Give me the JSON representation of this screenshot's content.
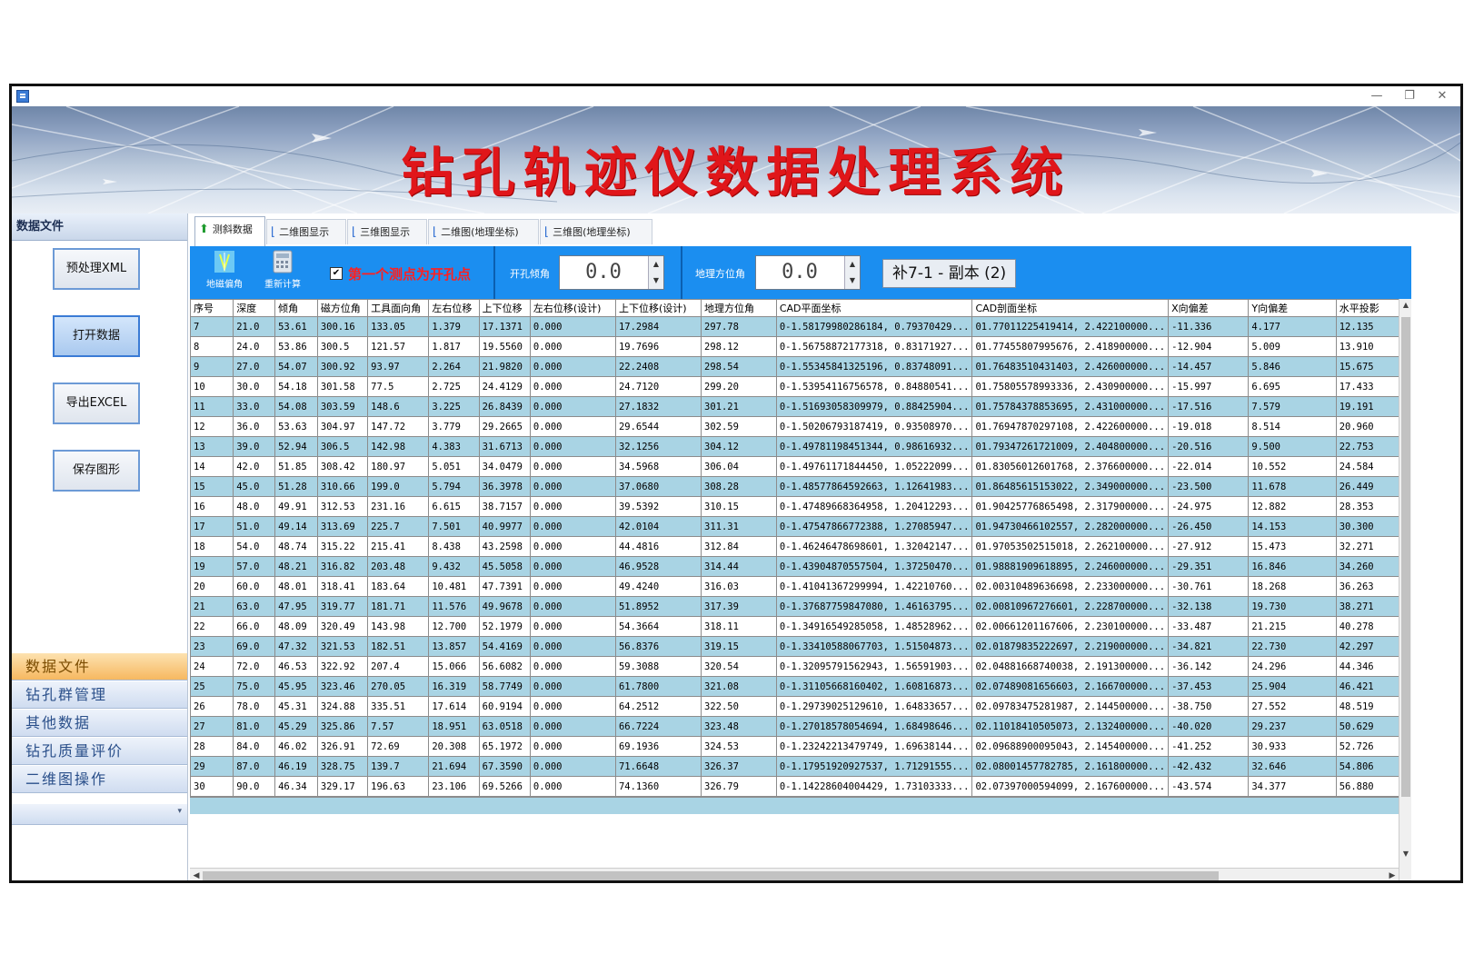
{
  "window": {
    "title_buttons": {
      "minimize": "—",
      "maximize": "❐",
      "close": "✕"
    }
  },
  "banner": {
    "title": "钻孔轨迹仪数据处理系统"
  },
  "left_panel": {
    "header": "数据文件",
    "buttons": [
      "预处理XML",
      "打开数据",
      "导出EXCEL",
      "保存图形"
    ],
    "active_button_index": 1,
    "nav_items": [
      "数据文件",
      "钻孔群管理",
      "其他数据",
      "钻孔质量评价",
      "二维图操作"
    ],
    "active_nav_index": 0
  },
  "tabs": {
    "items": [
      "测斜数据",
      "二维图显示",
      "三维图显示",
      "二维图(地理坐标)",
      "三维图(地理坐标)"
    ],
    "active_index": 0
  },
  "toolbar": {
    "btn_magnetic": "地磁偏角",
    "btn_recalc": "重新计算",
    "checkbox_label": "第一个测点为开孔点",
    "checkbox_checked": true,
    "hole_angle_label": "开孔倾角",
    "hole_angle_value": "0.0",
    "geo_azimuth_label": "地理方位角",
    "geo_azimuth_value": "0.0",
    "file_name": "补7-1 - 副本 (2)"
  },
  "table": {
    "columns": [
      "序号",
      "深度",
      "倾角",
      "磁方位角",
      "工具面向角",
      "左右位移",
      "上下位移",
      "左右位移(设计)",
      "上下位移(设计)",
      "地理方位角",
      "CAD平面坐标",
      "CAD剖面坐标",
      "X向偏差",
      "Y向偏差",
      "水平投影"
    ],
    "rows": [
      [
        "7",
        "21.0",
        "53.61",
        "300.16",
        "133.05",
        "1.379",
        "17.1371",
        "0.000",
        "17.2984",
        "297.78",
        "0-1.58179980286184, 0.79370429...",
        "01.77011225419414, 2.422100000...",
        "-11.336",
        "4.177",
        "12.135"
      ],
      [
        "8",
        "24.0",
        "53.86",
        "300.5",
        "121.57",
        "1.817",
        "19.5560",
        "0.000",
        "19.7696",
        "298.12",
        "0-1.56758872177318, 0.83171927...",
        "01.77455807995676, 2.418900000...",
        "-12.904",
        "5.009",
        "13.910"
      ],
      [
        "9",
        "27.0",
        "54.07",
        "300.92",
        "93.97",
        "2.264",
        "21.9820",
        "0.000",
        "22.2408",
        "298.54",
        "0-1.55345841325196, 0.83748091...",
        "01.76483510431403, 2.426000000...",
        "-14.457",
        "5.846",
        "15.675"
      ],
      [
        "10",
        "30.0",
        "54.18",
        "301.58",
        "77.5",
        "2.725",
        "24.4129",
        "0.000",
        "24.7120",
        "299.20",
        "0-1.53954116756578, 0.84880541...",
        "01.75805578993336, 2.430900000...",
        "-15.997",
        "6.695",
        "17.433"
      ],
      [
        "11",
        "33.0",
        "54.08",
        "303.59",
        "148.6",
        "3.225",
        "26.8439",
        "0.000",
        "27.1832",
        "301.21",
        "0-1.51693058309979, 0.88425904...",
        "01.75784378853695, 2.431000000...",
        "-17.516",
        "7.579",
        "19.191"
      ],
      [
        "12",
        "36.0",
        "53.63",
        "304.97",
        "147.72",
        "3.779",
        "29.2665",
        "0.000",
        "29.6544",
        "302.59",
        "0-1.50206793187419, 0.93508970...",
        "01.76947870297108, 2.422600000...",
        "-19.018",
        "8.514",
        "20.960"
      ],
      [
        "13",
        "39.0",
        "52.94",
        "306.5",
        "142.98",
        "4.383",
        "31.6713",
        "0.000",
        "32.1256",
        "304.12",
        "0-1.49781198451344, 0.98616932...",
        "01.79347261721009, 2.404800000...",
        "-20.516",
        "9.500",
        "22.753"
      ],
      [
        "14",
        "42.0",
        "51.85",
        "308.42",
        "180.97",
        "5.051",
        "34.0479",
        "0.000",
        "34.5968",
        "306.04",
        "0-1.49761171844450, 1.05222099...",
        "01.83056012601768, 2.376600000...",
        "-22.014",
        "10.552",
        "24.584"
      ],
      [
        "15",
        "45.0",
        "51.28",
        "310.66",
        "199.0",
        "5.794",
        "36.3978",
        "0.000",
        "37.0680",
        "308.28",
        "0-1.48577864592663, 1.12641983...",
        "01.86485615153022, 2.349000000...",
        "-23.500",
        "11.678",
        "26.449"
      ],
      [
        "16",
        "48.0",
        "49.91",
        "312.53",
        "231.16",
        "6.615",
        "38.7157",
        "0.000",
        "39.5392",
        "310.15",
        "0-1.47489668364958, 1.20412293...",
        "01.90425776865498, 2.317900000...",
        "-24.975",
        "12.882",
        "28.353"
      ],
      [
        "17",
        "51.0",
        "49.14",
        "313.69",
        "225.7",
        "7.501",
        "40.9977",
        "0.000",
        "42.0104",
        "311.31",
        "0-1.47547866772388, 1.27085947...",
        "01.94730466102557, 2.282000000...",
        "-26.450",
        "14.153",
        "30.300"
      ],
      [
        "18",
        "54.0",
        "48.74",
        "315.22",
        "215.41",
        "8.438",
        "43.2598",
        "0.000",
        "44.4816",
        "312.84",
        "0-1.46246478698601, 1.32042147...",
        "01.97053502515018, 2.262100000...",
        "-27.912",
        "15.473",
        "32.271"
      ],
      [
        "19",
        "57.0",
        "48.21",
        "316.82",
        "203.48",
        "9.432",
        "45.5058",
        "0.000",
        "46.9528",
        "314.44",
        "0-1.43904870557504, 1.37250470...",
        "01.98881909618895, 2.246000000...",
        "-29.351",
        "16.846",
        "34.260"
      ],
      [
        "20",
        "60.0",
        "48.01",
        "318.41",
        "183.64",
        "10.481",
        "47.7391",
        "0.000",
        "49.4240",
        "316.03",
        "0-1.41041367299994, 1.42210760...",
        "02.00310489636698, 2.233000000...",
        "-30.761",
        "18.268",
        "36.263"
      ],
      [
        "21",
        "63.0",
        "47.95",
        "319.77",
        "181.71",
        "11.576",
        "49.9678",
        "0.000",
        "51.8952",
        "317.39",
        "0-1.37687759847080, 1.46163795...",
        "02.00810967276601, 2.228700000...",
        "-32.138",
        "19.730",
        "38.271"
      ],
      [
        "22",
        "66.0",
        "48.09",
        "320.49",
        "143.98",
        "12.700",
        "52.1979",
        "0.000",
        "54.3664",
        "318.11",
        "0-1.34916549285058, 1.48528962...",
        "02.00661201167606, 2.230100000...",
        "-33.487",
        "21.215",
        "40.278"
      ],
      [
        "23",
        "69.0",
        "47.32",
        "321.53",
        "182.51",
        "13.857",
        "54.4169",
        "0.000",
        "56.8376",
        "319.15",
        "0-1.33410588067703, 1.51504873...",
        "02.01879835222697, 2.219000000...",
        "-34.821",
        "22.730",
        "42.297"
      ],
      [
        "24",
        "72.0",
        "46.53",
        "322.92",
        "207.4",
        "15.066",
        "56.6082",
        "0.000",
        "59.3088",
        "320.54",
        "0-1.32095791562943, 1.56591903...",
        "02.04881668740038, 2.191300000...",
        "-36.142",
        "24.296",
        "44.346"
      ],
      [
        "25",
        "75.0",
        "45.95",
        "323.46",
        "270.05",
        "16.319",
        "58.7749",
        "0.000",
        "61.7800",
        "321.08",
        "0-1.31105668160402, 1.60816873...",
        "02.07489081656603, 2.166700000...",
        "-37.453",
        "25.904",
        "46.421"
      ],
      [
        "26",
        "78.0",
        "45.31",
        "324.88",
        "335.51",
        "17.614",
        "60.9194",
        "0.000",
        "64.2512",
        "322.50",
        "0-1.29739025129610, 1.64833657...",
        "02.09783475281987, 2.144500000...",
        "-38.750",
        "27.552",
        "48.519"
      ],
      [
        "27",
        "81.0",
        "45.29",
        "325.86",
        "7.57",
        "18.951",
        "63.0518",
        "0.000",
        "66.7224",
        "323.48",
        "0-1.27018578054694, 1.68498646...",
        "02.11018410505073, 2.132400000...",
        "-40.020",
        "29.237",
        "50.629"
      ],
      [
        "28",
        "84.0",
        "46.02",
        "326.91",
        "72.69",
        "20.308",
        "65.1972",
        "0.000",
        "69.1936",
        "324.53",
        "0-1.23242213479749, 1.69638144...",
        "02.09688900095043, 2.145400000...",
        "-41.252",
        "30.933",
        "52.726"
      ],
      [
        "29",
        "87.0",
        "46.19",
        "328.75",
        "139.7",
        "21.694",
        "67.3590",
        "0.000",
        "71.6648",
        "326.37",
        "0-1.17951920927537, 1.71291555...",
        "02.08001457782785, 2.161800000...",
        "-42.432",
        "32.646",
        "54.806"
      ],
      [
        "30",
        "90.0",
        "46.34",
        "329.17",
        "196.63",
        "23.106",
        "69.5266",
        "0.000",
        "74.1360",
        "326.79",
        "0-1.14228604004429, 1.73103333...",
        "02.07397000594099, 2.167600000...",
        "-43.574",
        "34.377",
        "56.880"
      ]
    ]
  },
  "colors": {
    "banner_title": "#e0161a",
    "toolbar_bg": "#1b8ef0",
    "row_alt": "#a9d4e4",
    "checkbox_text": "#ff2020"
  }
}
